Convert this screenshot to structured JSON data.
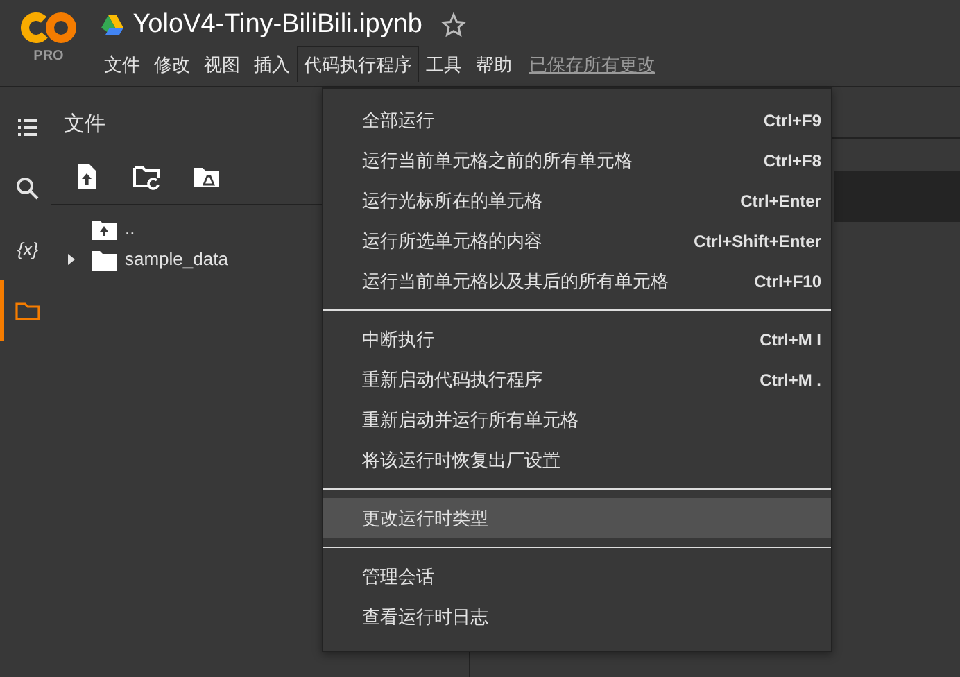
{
  "app": {
    "badge": "PRO"
  },
  "notebook": {
    "title": "YoloV4-Tiny-BiliBili.ipynb",
    "starred": false
  },
  "menubar": [
    {
      "label": "文件",
      "selected": false
    },
    {
      "label": "修改",
      "selected": false
    },
    {
      "label": "视图",
      "selected": false
    },
    {
      "label": "插入",
      "selected": false
    },
    {
      "label": "代码执行程序",
      "selected": true
    },
    {
      "label": "工具",
      "selected": false
    },
    {
      "label": "帮助",
      "selected": false
    }
  ],
  "save_status": "已保存所有更改",
  "rail": [
    {
      "kind": "toc",
      "selected": false
    },
    {
      "kind": "search",
      "selected": false
    },
    {
      "kind": "variables",
      "glyph": "{x}",
      "selected": false
    },
    {
      "kind": "files",
      "selected": true
    }
  ],
  "files_panel": {
    "title": "文件",
    "toolbar": [
      {
        "kind": "upload"
      },
      {
        "kind": "refresh"
      },
      {
        "kind": "drive"
      }
    ],
    "tree": [
      {
        "kind": "parent",
        "name": ".."
      },
      {
        "kind": "folder",
        "name": "sample_data",
        "expanded": false
      }
    ]
  },
  "menu": {
    "groups": [
      [
        {
          "label": "全部运行",
          "shortcut": "Ctrl+F9",
          "selected": false
        },
        {
          "label": "运行当前单元格之前的所有单元格",
          "shortcut": "Ctrl+F8",
          "selected": false
        },
        {
          "label": "运行光标所在的单元格",
          "shortcut": "Ctrl+Enter",
          "selected": false
        },
        {
          "label": "运行所选单元格的内容",
          "shortcut": "Ctrl+Shift+Enter",
          "selected": false
        },
        {
          "label": "运行当前单元格以及其后的所有单元格",
          "shortcut": "Ctrl+F10",
          "selected": false
        }
      ],
      [
        {
          "label": "中断执行",
          "shortcut": "Ctrl+M I",
          "selected": false
        },
        {
          "label": "重新启动代码执行程序",
          "shortcut": "Ctrl+M .",
          "selected": false
        },
        {
          "label": "重新启动并运行所有单元格",
          "selected": false
        },
        {
          "label": "将该运行时恢复出厂设置",
          "selected": false
        }
      ],
      [
        {
          "label": "更改运行时类型",
          "selected": true
        }
      ],
      [
        {
          "label": "管理会话",
          "selected": false
        },
        {
          "label": "查看运行时日志",
          "selected": false
        }
      ]
    ]
  }
}
